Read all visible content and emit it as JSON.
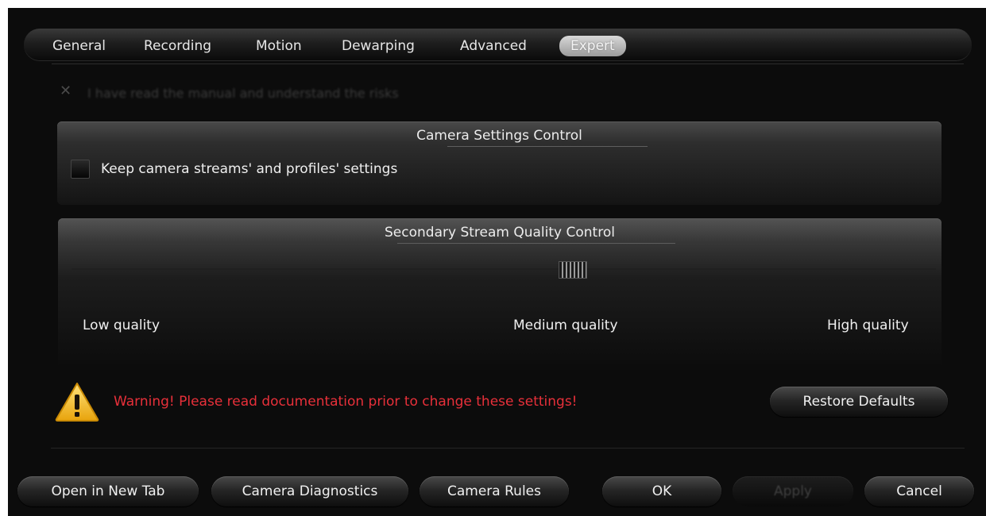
{
  "tabs": [
    "General",
    "Recording",
    "Motion",
    "Dewarping",
    "Advanced",
    "Expert"
  ],
  "active_tab": "Expert",
  "read_manual": {
    "label": "I have read the manual and understand the risks",
    "mark": "✕",
    "enabled": false
  },
  "camera_settings": {
    "title": "Camera Settings Control",
    "checkbox_label": "Keep camera streams' and profiles' settings",
    "checked": false
  },
  "stream_quality": {
    "title": "Secondary Stream Quality Control",
    "low_label": "Low quality",
    "medium_label": "Medium quality",
    "high_label": "High quality",
    "level": "medium"
  },
  "warning": {
    "text": "Warning! Please read documentation prior to change these settings!",
    "icon": "warning-triangle-icon",
    "color": "#e8303a"
  },
  "buttons": {
    "restore_defaults": "Restore Defaults",
    "open_new_tab": "Open in New Tab",
    "camera_diagnostics": "Camera Diagnostics",
    "camera_rules": "Camera Rules",
    "ok": "OK",
    "apply": "Apply",
    "cancel": "Cancel"
  }
}
